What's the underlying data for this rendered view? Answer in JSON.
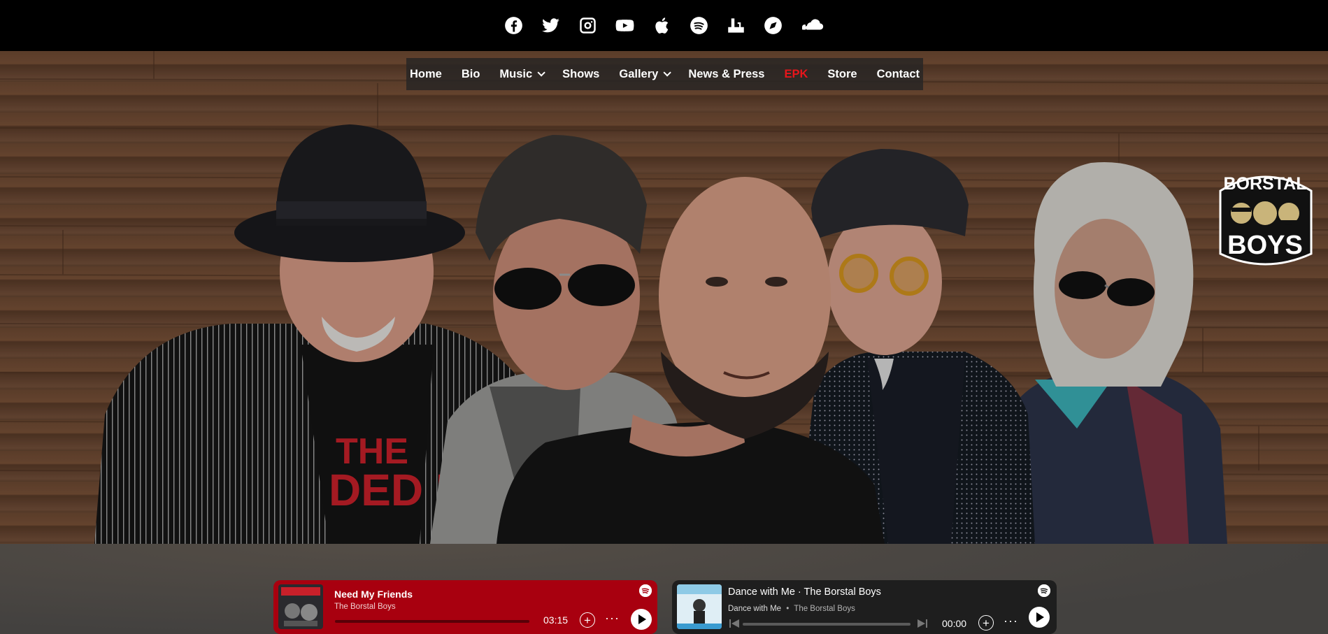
{
  "social": {
    "icons": [
      "facebook-icon",
      "twitter-icon",
      "instagram-icon",
      "youtube-icon",
      "apple-icon",
      "spotify-icon",
      "bandsintown-icon",
      "compass-icon",
      "soundcloud-icon"
    ]
  },
  "nav": {
    "items": [
      {
        "label": "Home"
      },
      {
        "label": "Bio"
      },
      {
        "label": "Music"
      },
      {
        "label": "Shows"
      },
      {
        "label": "Gallery"
      },
      {
        "label": "News & Press"
      },
      {
        "label": "EPK"
      },
      {
        "label": "Store"
      },
      {
        "label": "Contact"
      }
    ],
    "active_color": "#e8151b"
  },
  "logo": {
    "line1": "BORSTAL",
    "line2": "BOYS"
  },
  "players": {
    "first": {
      "title": "Need My Friends",
      "artist": "The Borstal Boys",
      "time": "03:15",
      "background": "#a8000f",
      "progress": 0
    },
    "second": {
      "title": "Dance with Me · The Borstal Boys",
      "track": "Dance with Me",
      "separator": "•",
      "artist": "The Borstal Boys",
      "time": "00:00",
      "background": "#1e1e1e",
      "progress": 0
    }
  },
  "shirt_text": {
    "line1": "THE",
    "line2": "DED K"
  }
}
